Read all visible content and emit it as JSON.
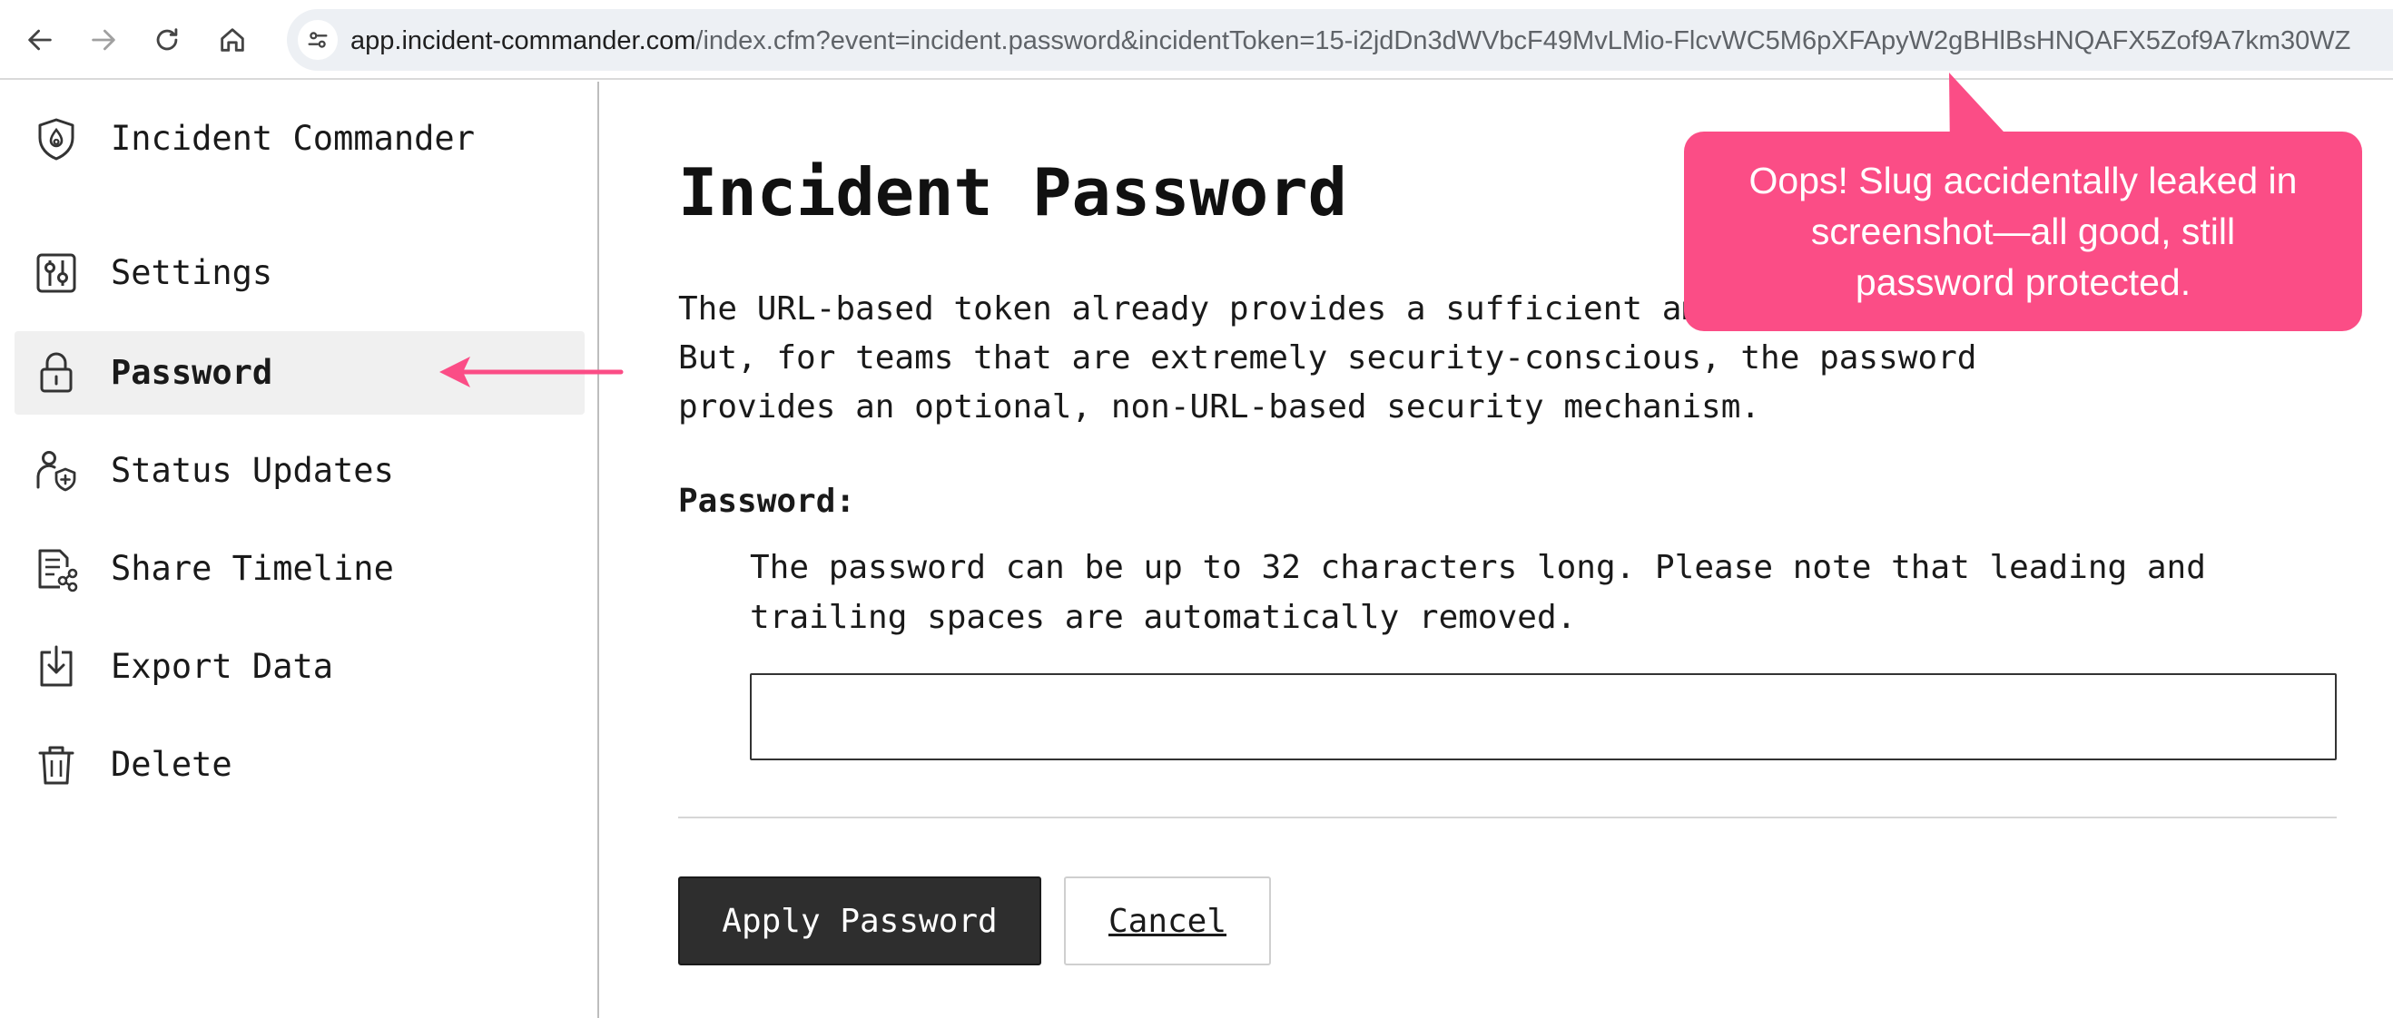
{
  "browser": {
    "back_icon": "arrow-left-icon",
    "forward_icon": "arrow-right-icon",
    "reload_icon": "reload-icon",
    "home_icon": "home-icon",
    "site_info_icon": "tune-icon",
    "url_host": "app.incident-commander.com",
    "url_rest": "/index.cfm?event=incident.password&incidentToken=15-i2jdDn3dWVbcF49MvLMio-FlcvWC5M6pXFApyW2gBHlBsHNQAFX5Zof9A7km30WZ"
  },
  "sidebar": {
    "items": [
      {
        "label": "Incident Commander",
        "icon": "shield-flame-icon",
        "active": false
      },
      {
        "label": "Settings",
        "icon": "sliders-icon",
        "active": false
      },
      {
        "label": "Password",
        "icon": "lock-icon",
        "active": true
      },
      {
        "label": "Status Updates",
        "icon": "person-shield-icon",
        "active": false
      },
      {
        "label": "Share Timeline",
        "icon": "document-share-icon",
        "active": false
      },
      {
        "label": "Export Data",
        "icon": "download-box-icon",
        "active": false
      },
      {
        "label": "Delete",
        "icon": "trash-icon",
        "active": false
      }
    ]
  },
  "main": {
    "title": "Incident Password",
    "intro": "The URL-based token already provides a sufficient amount of security. But, for teams that are extremely security-conscious, the password provides an optional, non-URL-based security mechanism.",
    "field_label": "Password:",
    "help_text": "The password can be up to 32 characters long. Please note that leading and trailing spaces are automatically removed.",
    "password_value": "",
    "apply_label": "Apply Password",
    "cancel_label": "Cancel"
  },
  "annotation": {
    "callout_text": "Oops! Slug accidentally leaked in screenshot—all good, still password protected.",
    "color": "#fb4d86"
  }
}
